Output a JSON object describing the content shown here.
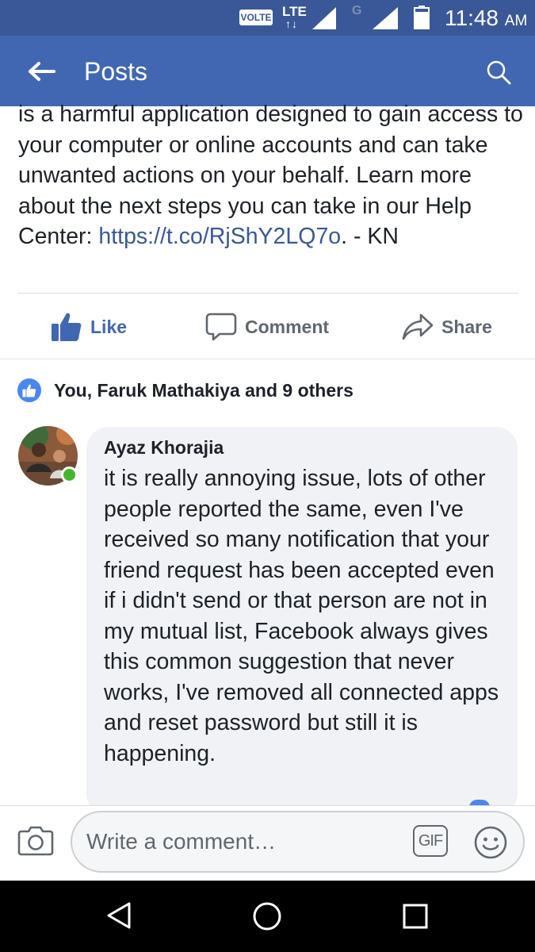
{
  "status_bar": {
    "volte": "VOLTE",
    "lte": "LTE",
    "lte_arrows": "↑↓",
    "g": "G",
    "battery": "79",
    "time": "11:48",
    "ampm": "AM"
  },
  "app_bar": {
    "title": "Posts",
    "back_icon": "arrow-left-icon",
    "search_icon": "search-icon"
  },
  "post": {
    "text_before_link": "is a harmful application designed to gain access to your computer or online accounts and can take unwanted actions on your behalf. Learn more about the next steps you can take in our Help Center: ",
    "link": "https://t.co/RjShY2LQ7o",
    "text_after_link": ". - KN"
  },
  "actions": {
    "like": "Like",
    "comment": "Comment",
    "share": "Share"
  },
  "reactions": {
    "text": "You, Faruk Mathakiya and 9 others"
  },
  "comment": {
    "author": "Ayaz Khorajia",
    "text": "it is really annoying issue, lots of other people reported the same, even I've received so many notification that your friend request has been accepted even if i didn't send or that person are not in my mutual list, Facebook always gives this common suggestion that never works, I've removed all connected apps and reset password but still it is happening."
  },
  "composer": {
    "placeholder": "Write a comment…",
    "gif_label": "GIF"
  },
  "colors": {
    "status_bar": "#3a5897",
    "app_bar": "#4267b2",
    "link": "#385898",
    "online": "#42b72a"
  }
}
